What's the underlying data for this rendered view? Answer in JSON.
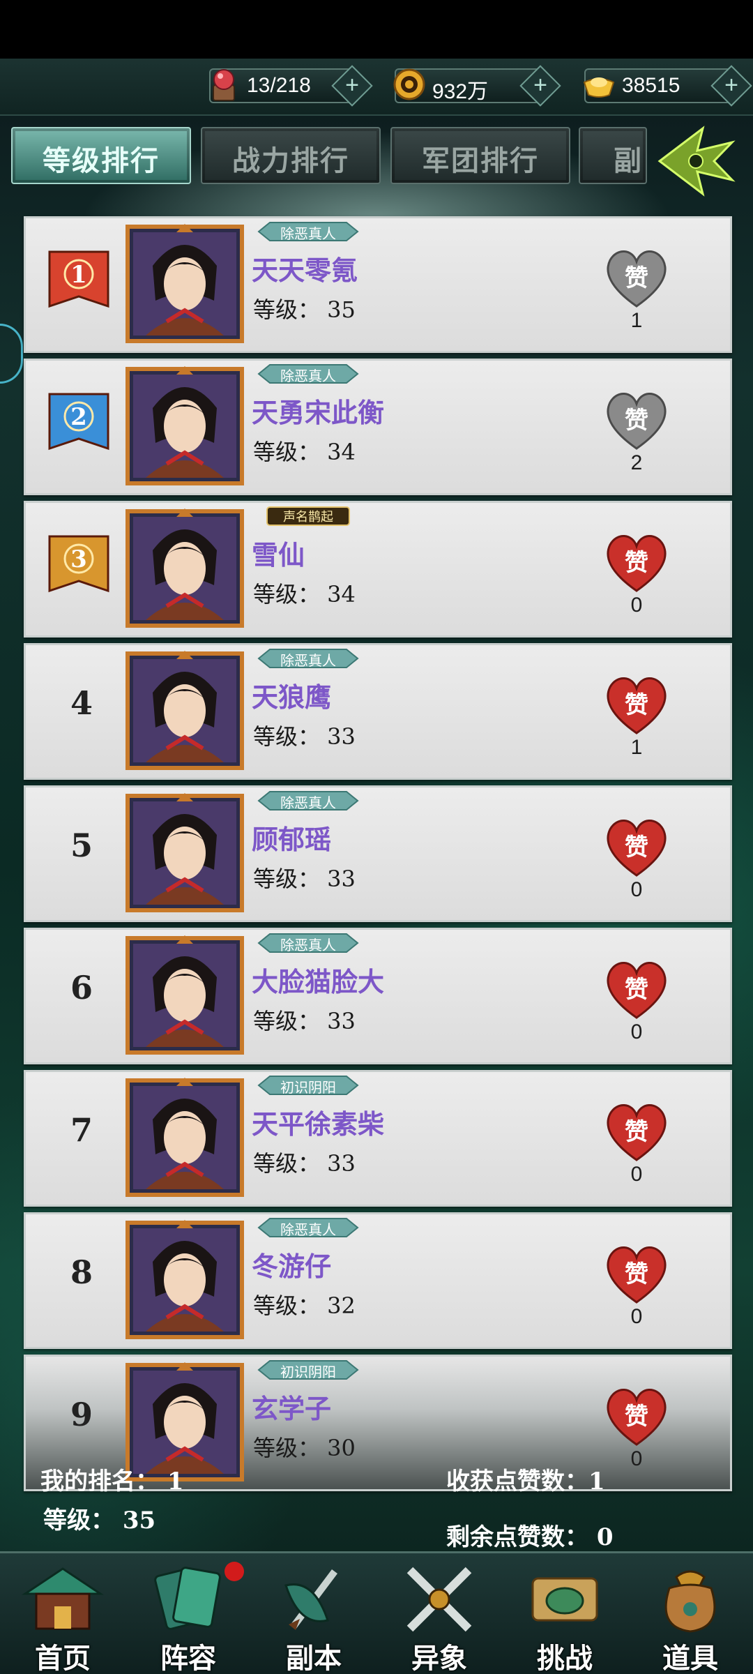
{
  "resources": [
    {
      "icon": "stamina-icon",
      "value": "13/218"
    },
    {
      "icon": "coin-icon",
      "value": "932万"
    },
    {
      "icon": "ingot-icon",
      "value": "38515"
    }
  ],
  "tabs": [
    {
      "label": "等级排行",
      "active": true
    },
    {
      "label": "战力排行",
      "active": false
    },
    {
      "label": "军团排行",
      "active": false
    },
    {
      "label": "副",
      "active": false
    }
  ],
  "ranking": [
    {
      "rank": "1",
      "title": "除恶真人",
      "name": "天天零氪",
      "level": "等级： 35",
      "likes": "1",
      "liked": true
    },
    {
      "rank": "2",
      "title": "除恶真人",
      "name": "天勇宋此衡",
      "level": "等级： 34",
      "likes": "2",
      "liked": true
    },
    {
      "rank": "3",
      "title": "声名鹊起",
      "name": "雪仙",
      "level": "等级： 34",
      "likes": "0",
      "liked": false
    },
    {
      "rank": "4",
      "title": "除恶真人",
      "name": "天狼鹰",
      "level": "等级： 33",
      "likes": "1",
      "liked": false
    },
    {
      "rank": "5",
      "title": "除恶真人",
      "name": "顾郁瑶",
      "level": "等级： 33",
      "likes": "0",
      "liked": false
    },
    {
      "rank": "6",
      "title": "除恶真人",
      "name": "大脸猫脸大",
      "level": "等级： 33",
      "likes": "0",
      "liked": false
    },
    {
      "rank": "7",
      "title": "初识阴阳",
      "name": "天平徐素柴",
      "level": "等级： 33",
      "likes": "0",
      "liked": false
    },
    {
      "rank": "8",
      "title": "除恶真人",
      "name": "冬游仔",
      "level": "等级： 32",
      "likes": "0",
      "liked": false
    },
    {
      "rank": "9",
      "title": "初识阴阳",
      "name": "玄学子",
      "level": "等级： 30",
      "likes": "0",
      "liked": false
    }
  ],
  "like_label": "赞",
  "my_info": {
    "my_rank": "我的排名： 1",
    "my_level": "等级： 35",
    "received_likes": "收获点赞数：1",
    "remaining_likes": "剩余点赞数： 0"
  },
  "nav": [
    {
      "label": "首页",
      "icon": "home-icon"
    },
    {
      "label": "阵容",
      "icon": "lineup-icon"
    },
    {
      "label": "副本",
      "icon": "dungeon-icon"
    },
    {
      "label": "异象",
      "icon": "phenomenon-icon"
    },
    {
      "label": "挑战",
      "icon": "challenge-icon"
    },
    {
      "label": "道具",
      "icon": "items-icon"
    }
  ],
  "colors": {
    "name": "#7d57c8",
    "heart_active": "#c9302a",
    "heart_used": "#8a8a8a"
  }
}
